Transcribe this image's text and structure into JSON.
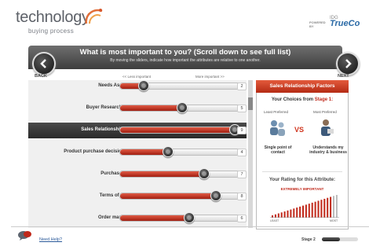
{
  "header": {
    "logo_main": "technology",
    "logo_sub": "buying process",
    "powered_by": "POWERED\nBY",
    "powered_logo_small": "IDG",
    "powered_logo_brand": "TrueCo"
  },
  "banner": {
    "title": "What is most important to you? (Scroll down to see full list)",
    "subtitle": "By moving the sliders, indicate how important the attributes are relative to one another."
  },
  "nav": {
    "back_label": "BACK",
    "next_label": "NEXT"
  },
  "scale": {
    "less": "<< Less important",
    "more": "More important >>"
  },
  "attributes": [
    {
      "label": "Needs Assessment",
      "value": 2,
      "slider": 0.2,
      "selected": false
    },
    {
      "label": "Buyer Research Support",
      "value": 5,
      "slider": 0.52,
      "selected": false
    },
    {
      "label": "Sales Relationship Factors",
      "value": 9,
      "slider": 0.97,
      "selected": true
    },
    {
      "label": "Product purchase decision factors",
      "value": 4,
      "slider": 0.4,
      "selected": false
    },
    {
      "label": "Purchase process",
      "value": 7,
      "slider": 0.7,
      "selected": false
    },
    {
      "label": "Terms of purchase",
      "value": 8,
      "slider": 0.8,
      "selected": false
    },
    {
      "label": "Order management",
      "value": 6,
      "slider": 0.58,
      "selected": false
    }
  ],
  "right_panel": {
    "header": "Sales Relationship Factors",
    "choices_prefix": "Your Choices from ",
    "choices_stage": "Stage 1:",
    "least_label": "Least Preferred",
    "most_label": "Most Preferred",
    "vs": "VS",
    "left_choice": "Single point of contact",
    "right_choice": "Understands my industry & business",
    "rating_title": "Your Rating for this Attribute:",
    "rating_value": "EXTREMELY IMPORTANT",
    "least": "LEAST",
    "most": "MOST"
  },
  "footer": {
    "help": "Need Help?",
    "stage_label": "Stage 2",
    "stage_progress": 0.5
  },
  "colors": {
    "accent": "#c0281a",
    "banner": "#4a4a4a"
  }
}
